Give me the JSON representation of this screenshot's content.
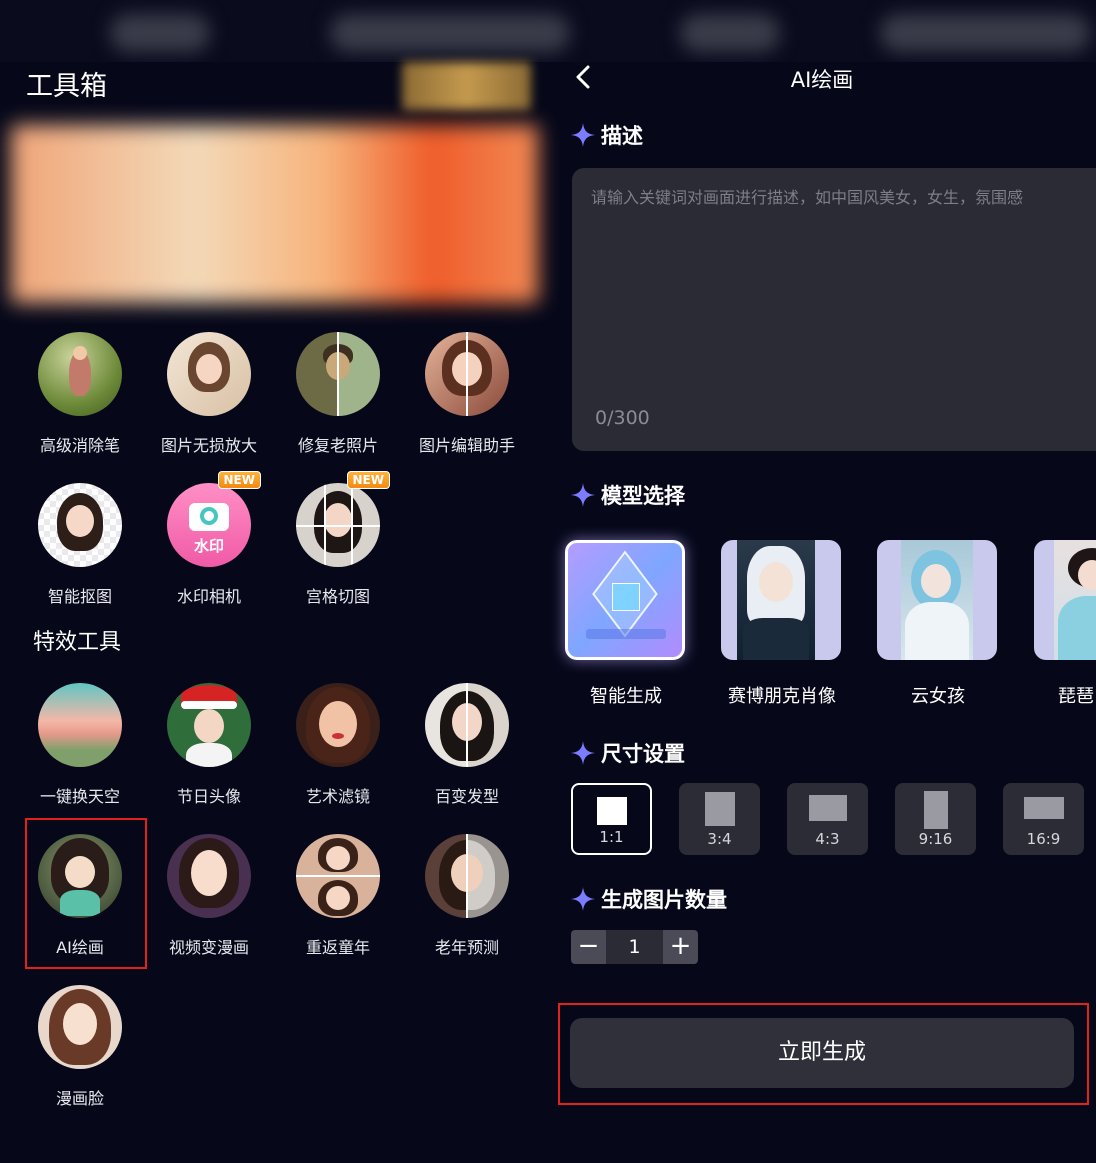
{
  "left_panel": {
    "title": "工具箱",
    "tools": [
      {
        "label": "高级消除笔"
      },
      {
        "label": "图片无损放大"
      },
      {
        "label": "修复老照片"
      },
      {
        "label": "图片编辑助手"
      },
      {
        "label": "智能抠图"
      },
      {
        "label": "水印相机",
        "badge": "NEW",
        "icon_text": "水印"
      },
      {
        "label": "宫格切图",
        "badge": "NEW"
      }
    ],
    "effects_title": "特效工具",
    "effects": [
      {
        "label": "一键换天空"
      },
      {
        "label": "节日头像"
      },
      {
        "label": "艺术滤镜"
      },
      {
        "label": "百变发型"
      },
      {
        "label": "AI绘画"
      },
      {
        "label": "视频变漫画"
      },
      {
        "label": "重返童年"
      },
      {
        "label": "老年预测"
      },
      {
        "label": "漫画脸"
      }
    ]
  },
  "right_panel": {
    "title": "AI绘画",
    "description": {
      "heading": "描述",
      "placeholder": "请输入关键词对画面进行描述，如中国风美女，女生，氛围感",
      "value": "",
      "char_count": "0/300"
    },
    "model_section": {
      "heading": "模型选择",
      "models": [
        {
          "label": "智能生成"
        },
        {
          "label": "赛博朋克肖像"
        },
        {
          "label": "云女孩"
        },
        {
          "label": "琵琶"
        }
      ]
    },
    "size_section": {
      "heading": "尺寸设置",
      "options": [
        "1:1",
        "3:4",
        "4:3",
        "9:16",
        "16:9"
      ],
      "selected": "1:1"
    },
    "count_section": {
      "heading": "生成图片数量",
      "minus": "−",
      "value": "1",
      "plus": "+"
    },
    "generate_label": "立即生成"
  },
  "colors": {
    "background": "#06081a",
    "panel": "#2a2b34",
    "highlight_border": "#e32020",
    "accent_star": "#7b7cff",
    "badge_orange": "#f28a10"
  }
}
